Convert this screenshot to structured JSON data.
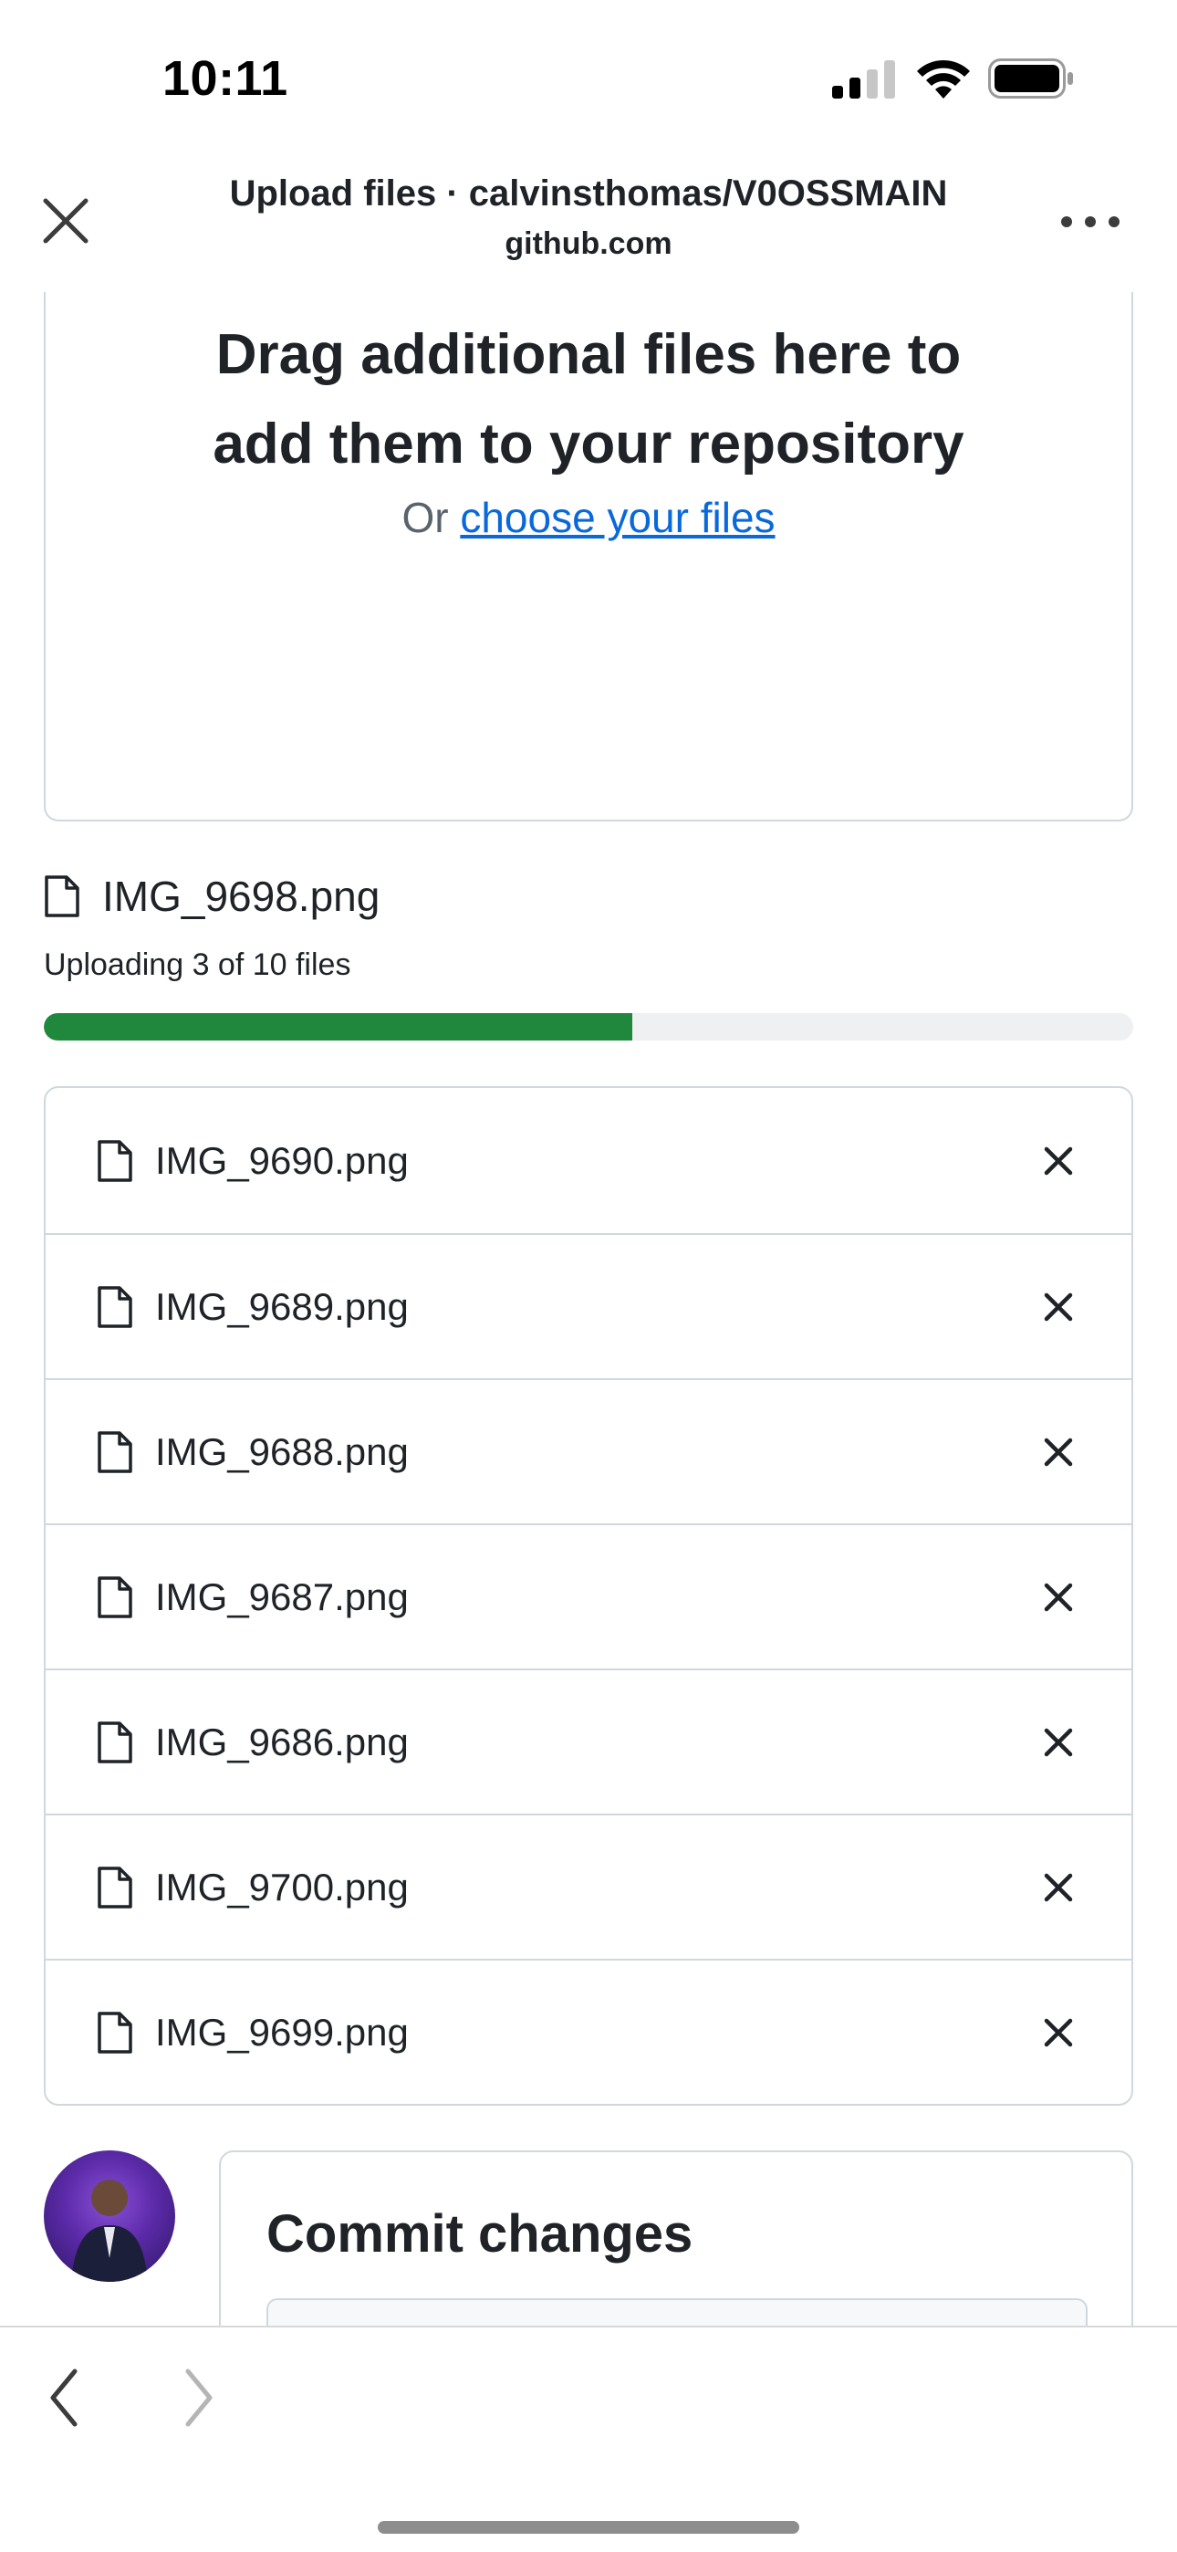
{
  "status_bar": {
    "time": "10:11",
    "icons": [
      "cellular-signal-icon",
      "wifi-icon",
      "battery-icon"
    ]
  },
  "browser_header": {
    "title": "Upload files · calvinsthomas/V0OSSMAIN",
    "domain": "github.com",
    "close_icon": "close-icon",
    "more_icon": "more-options-icon"
  },
  "dropzone": {
    "heading_line1": "Drag additional files here to",
    "heading_line2": "add them to your repository",
    "or_text": "Or",
    "link_text": "choose your files"
  },
  "upload": {
    "current_file": "IMG_9698.png",
    "progress_text": "Uploading 3 of 10 files",
    "progress_fraction": 0.54
  },
  "files": [
    {
      "name": "IMG_9690.png"
    },
    {
      "name": "IMG_9689.png"
    },
    {
      "name": "IMG_9688.png"
    },
    {
      "name": "IMG_9687.png"
    },
    {
      "name": "IMG_9686.png"
    },
    {
      "name": "IMG_9700.png"
    },
    {
      "name": "IMG_9699.png"
    }
  ],
  "commit": {
    "title": "Commit changes"
  },
  "toolbar": {
    "back_icon": "back-chevron-icon",
    "forward_icon": "forward-chevron-icon"
  },
  "colors": {
    "progress": "#1f883d",
    "link": "#0969da",
    "border": "#d0d7de"
  }
}
